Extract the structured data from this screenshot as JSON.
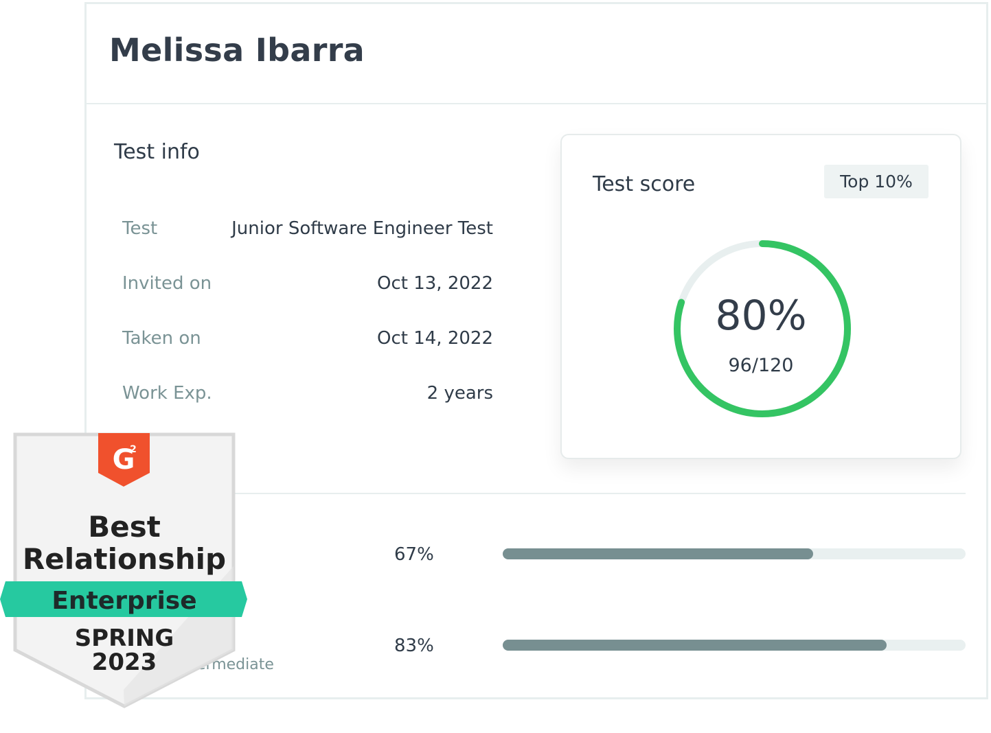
{
  "candidate": {
    "name": "Melissa Ibarra"
  },
  "test_info": {
    "title": "Test info",
    "rows": [
      {
        "label": "Test",
        "value": "Junior Software Engineer Test"
      },
      {
        "label": "Invited on",
        "value": "Oct 13, 2022"
      },
      {
        "label": "Taken on",
        "value": "Oct 14, 2022"
      },
      {
        "label": "Work Exp.",
        "value": "2 years"
      }
    ]
  },
  "score": {
    "title": "Test score",
    "rank_badge": "Top 10%",
    "percent_label": "80%",
    "points_label": "96/120",
    "fraction": 0.8,
    "colors": {
      "ring": "#34c463",
      "ring_track": "#e8efef"
    }
  },
  "skills": [
    {
      "name": "",
      "level": "",
      "percent_label": "67%",
      "fraction": 0.67
    },
    {
      "name": "",
      "level": "ermediate",
      "percent_label": "83%",
      "fraction": 0.83
    }
  ],
  "badge": {
    "logo_icon": "g2-logo-icon",
    "line1": "Best",
    "line2": "Relationship",
    "line3": "Enterprise",
    "line4": "SPRING",
    "line5": "2023",
    "colors": {
      "logo": "#f0512d",
      "ribbon": "#26c9a0",
      "frame": "#d8d8d8",
      "fill": "#f3f3f3"
    }
  }
}
